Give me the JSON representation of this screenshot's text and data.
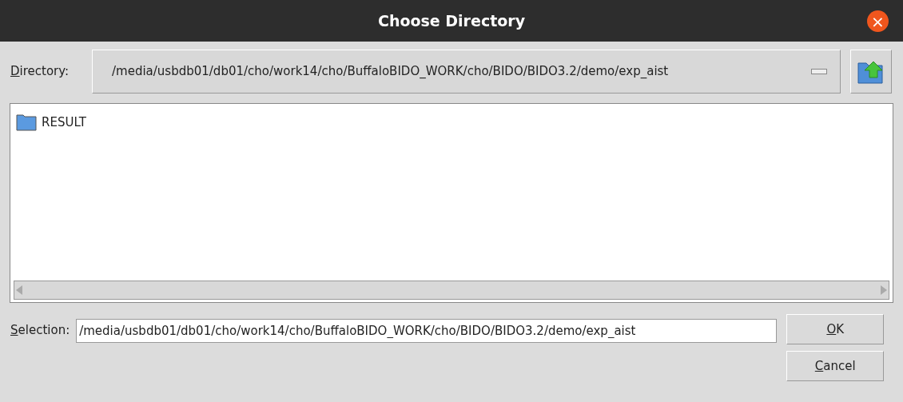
{
  "window": {
    "title": "Choose Directory",
    "close": "×"
  },
  "directory": {
    "label": "Directory:",
    "mnemonic": true,
    "value": "/media/usbdb01/db01/cho/work14/cho/BuffaloBIDO_WORK/cho/BIDO/BIDO3.2/demo/exp_aist"
  },
  "files": [
    {
      "name": "RESULT",
      "selected": false
    }
  ],
  "selection": {
    "label": "Selection:",
    "mnemonic": true,
    "value": "/media/usbdb01/db01/cho/work14/cho/BuffaloBIDO_WORK/cho/BIDO/BIDO3.2/demo/exp_aist"
  },
  "buttons": [
    {
      "label": "OK",
      "mnemonic": true
    },
    {
      "label": "Cancel",
      "mnemonic": true
    }
  ]
}
